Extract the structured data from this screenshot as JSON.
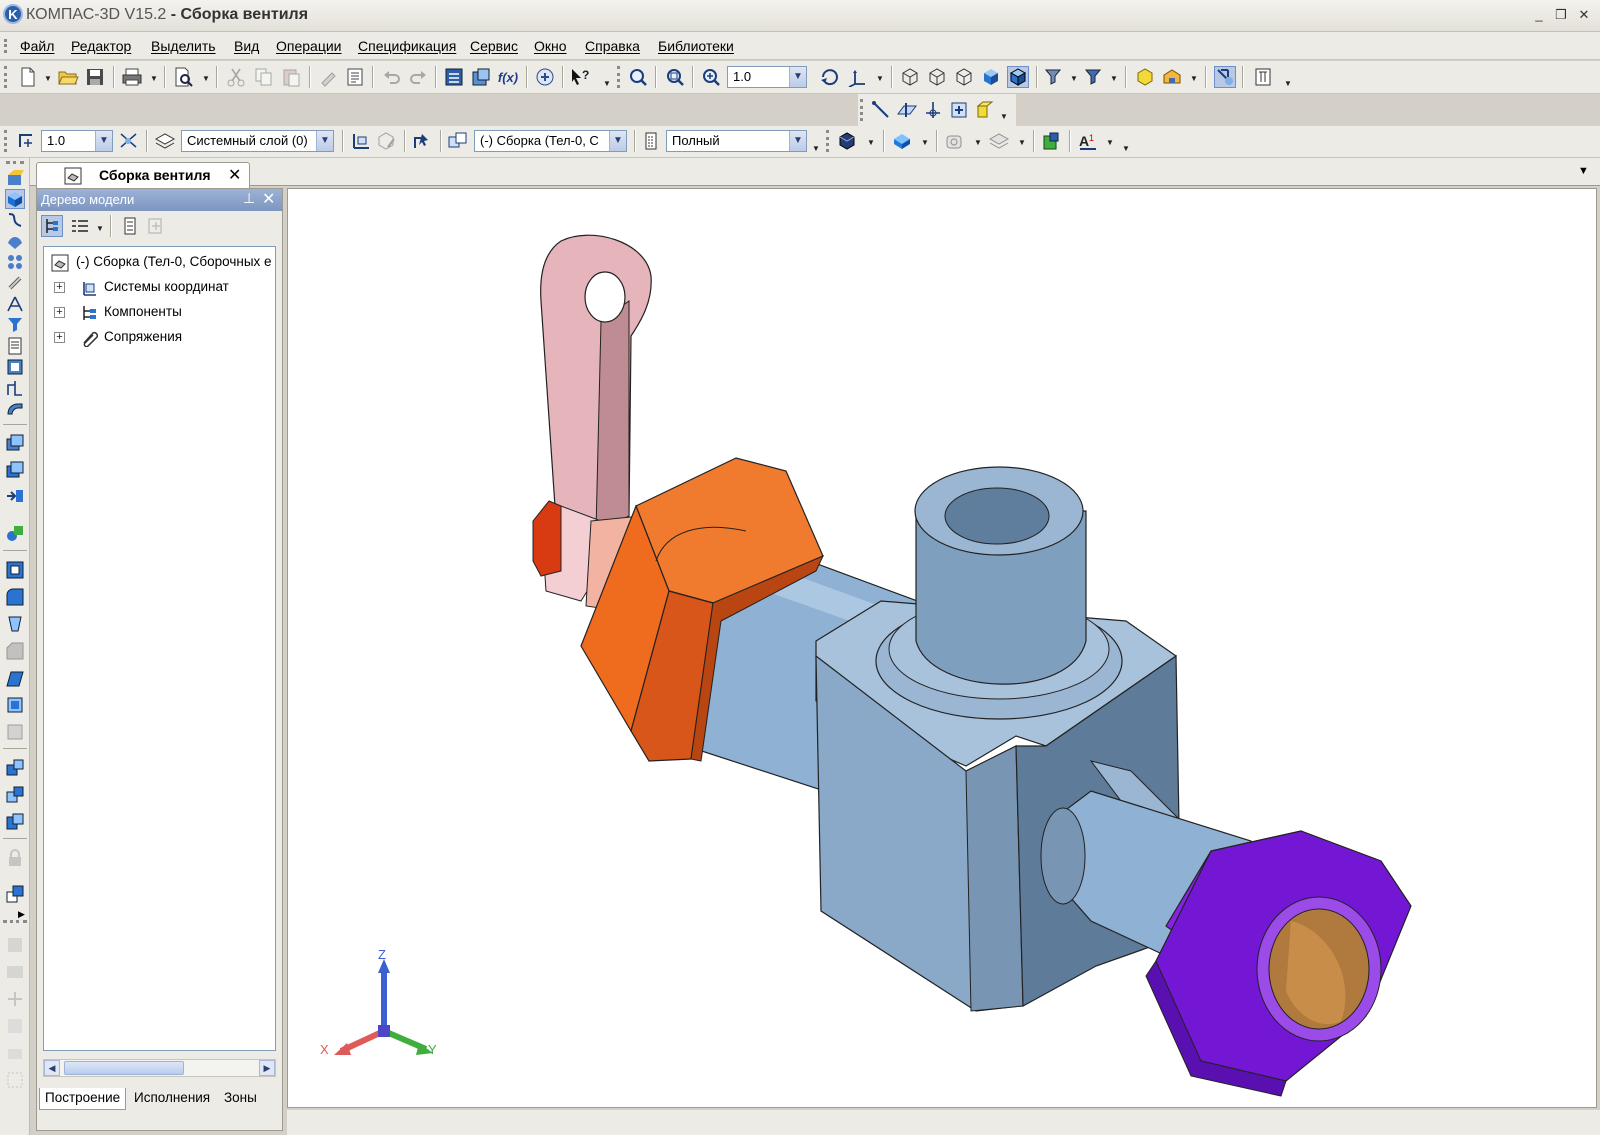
{
  "window": {
    "app_name": "КОМПАС-3D V15.2",
    "doc_title": "- Сборка вентиля",
    "logo_letter": "K",
    "controls": {
      "minimize": "_",
      "restore": "❐",
      "close": "✕"
    }
  },
  "menu": [
    "Файл",
    "Редактор",
    "Выделить",
    "Вид",
    "Операции",
    "Спецификация",
    "Сервис",
    "Окно",
    "Справка",
    "Библиотеки"
  ],
  "toolbar": {
    "zoom_value": "1.0",
    "step_value": "1.0",
    "layer_value": "Системный слой (0)",
    "assembly_value": "(-) Сборка (Тел-0, С",
    "view_mode_value": "Полный"
  },
  "document_tab": {
    "label": "Сборка вентиля",
    "close": "✕"
  },
  "tree_panel": {
    "title": "Дерево модели",
    "pin": "⊥",
    "close": "✕",
    "root": "(-) Сборка (Тел-0, Сборочных е",
    "items": [
      {
        "label": "Системы координат",
        "icon": "coordinate-system-icon"
      },
      {
        "label": "Компоненты",
        "icon": "components-icon"
      },
      {
        "label": "Сопряжения",
        "icon": "mates-icon"
      }
    ],
    "expander_symbol": "+",
    "bottom_tabs": [
      "Построение",
      "Исполнения",
      "Зоны"
    ]
  },
  "triad": {
    "z": "Z",
    "x": "X",
    "y": "Y"
  },
  "colors": {
    "body": "#8aa8c8",
    "nut_orange": "#ef6b1e",
    "nut_purple": "#7417d4",
    "handle": "#e0aab0",
    "accent": "#7d95c0"
  }
}
